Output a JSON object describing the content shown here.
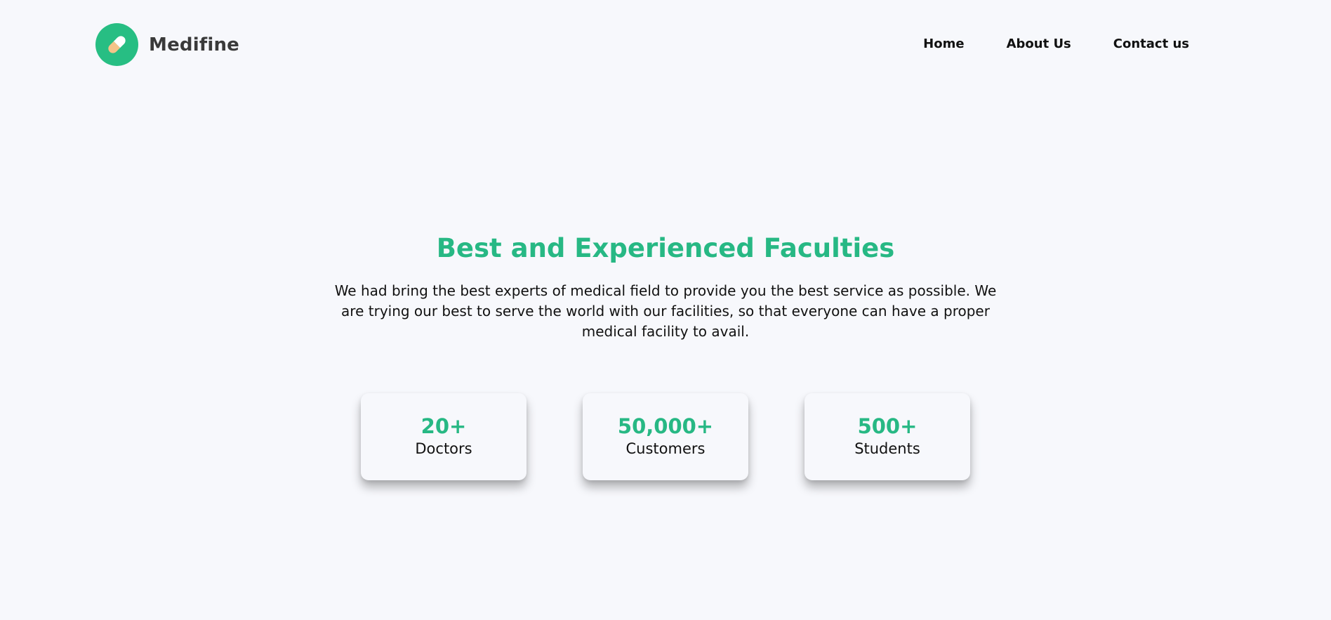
{
  "brand": {
    "name": "Medifine",
    "logo_icon": "pill-icon",
    "accent_color": "#27be83"
  },
  "nav": {
    "items": [
      {
        "label": "Home"
      },
      {
        "label": "About Us"
      },
      {
        "label": "Contact us"
      }
    ]
  },
  "hero": {
    "title": "Best and Experienced Faculties",
    "description": "We had bring the best experts of medical field to provide you the best service as possible. We are trying our best to serve the world with our facilities, so that everyone can have a proper medical facility to avail."
  },
  "stats": [
    {
      "value": "20+",
      "label": "Doctors"
    },
    {
      "value": "50,000+",
      "label": "Customers"
    },
    {
      "value": "500+",
      "label": "Students"
    }
  ],
  "colors": {
    "background": "#f7f8fc",
    "accent": "#27b884",
    "text": "#111111"
  }
}
